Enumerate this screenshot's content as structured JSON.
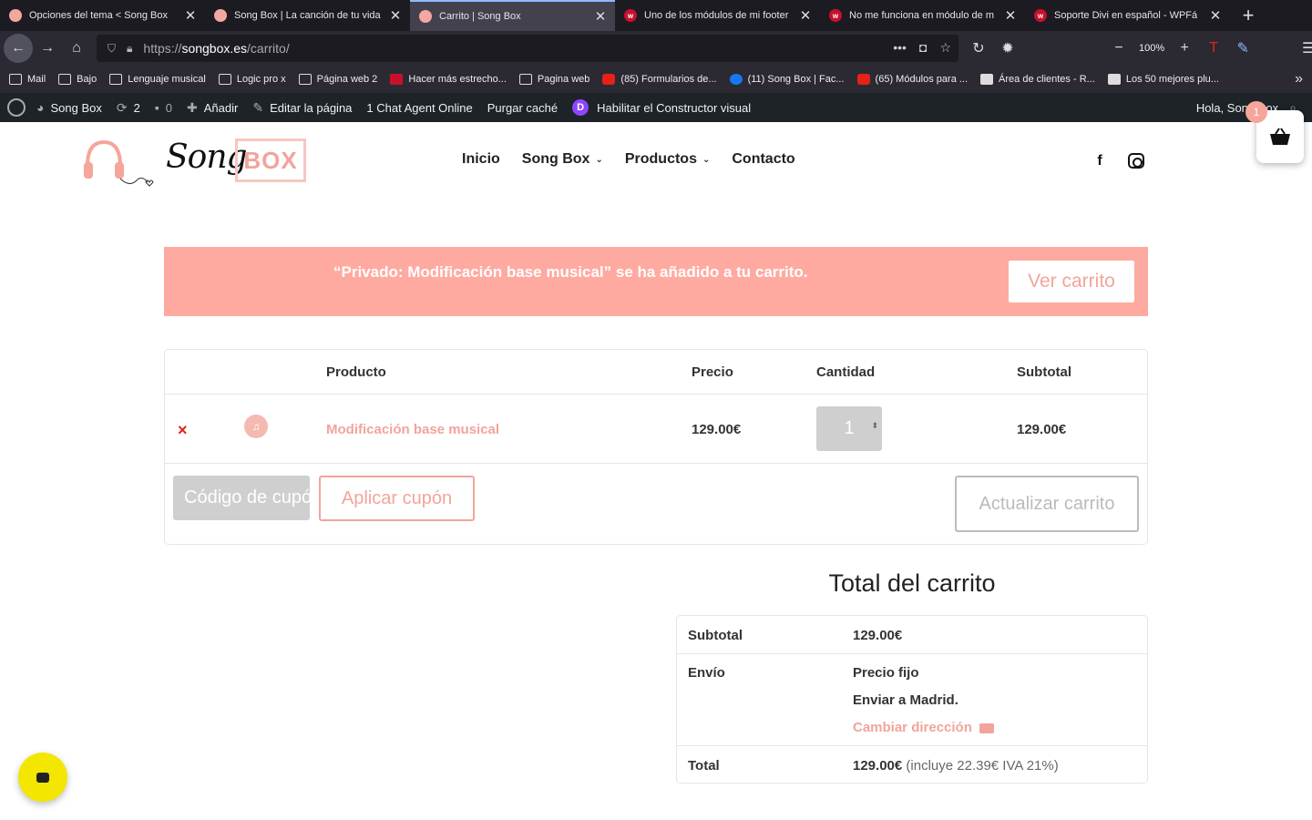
{
  "browser": {
    "tabs": [
      {
        "title": "Opciones del tema < Song Box",
        "favicon": "songbox-favicon",
        "active": false
      },
      {
        "title": "Song Box | La canción de tu vida",
        "favicon": "songbox-favicon",
        "active": false
      },
      {
        "title": "Carrito | Song Box",
        "favicon": "songbox-favicon",
        "active": true
      },
      {
        "title": "Uno de los módulos de mi footer",
        "favicon": "wpfacil-favicon",
        "active": false
      },
      {
        "title": "No me funciona en módulo de m",
        "favicon": "wpfacil-favicon",
        "active": false
      },
      {
        "title": "Soporte Divi en español - WPFá",
        "favicon": "wpfacil-favicon",
        "active": false
      }
    ],
    "url_prefix": "https://",
    "url_host": "songbox.es",
    "url_path": "/carrito/",
    "zoom": "100%",
    "bookmarks": [
      {
        "label": "Mail",
        "icon": "folder"
      },
      {
        "label": "Bajo",
        "icon": "folder"
      },
      {
        "label": "Lenguaje musical",
        "icon": "folder"
      },
      {
        "label": "Logic pro x",
        "icon": "folder"
      },
      {
        "label": "Página web 2",
        "icon": "folder"
      },
      {
        "label": "Hacer más estrecho...",
        "icon": "wp"
      },
      {
        "label": "Pagina web",
        "icon": "folder"
      },
      {
        "label": "(85) Formularios de...",
        "icon": "yt"
      },
      {
        "label": "(11) Song Box | Fac...",
        "icon": "fb"
      },
      {
        "label": "(65) Módulos para ...",
        "icon": "yt"
      },
      {
        "label": "Área de clientes - R...",
        "icon": "other"
      },
      {
        "label": "Los 50 mejores plu...",
        "icon": "other"
      }
    ]
  },
  "adminbar": {
    "site": "Song Box",
    "updates": "2",
    "comments": "0",
    "add": "Añadir",
    "edit": "Editar la página",
    "chat": "1 Chat Agent Online",
    "purge": "Purgar caché",
    "divi": "Habilitar el Constructor visual",
    "divi_letter": "D",
    "greeting": "Hola, Song Box"
  },
  "header": {
    "logo_script": "Song",
    "logo_box": "BOX",
    "menu": [
      {
        "label": "Inicio",
        "dropdown": false
      },
      {
        "label": "Song Box",
        "dropdown": true
      },
      {
        "label": "Productos",
        "dropdown": true
      },
      {
        "label": "Contacto",
        "dropdown": false
      }
    ],
    "facebook_glyph": "f",
    "cart_count": "1"
  },
  "notice": {
    "text": "“Privado: Modificación base musical” se ha añadido a tu carrito.",
    "button": "Ver carrito"
  },
  "cart": {
    "headers": {
      "product": "Producto",
      "price": "Precio",
      "quantity": "Cantidad",
      "subtotal": "Subtotal"
    },
    "item": {
      "remove": "×",
      "name": "Modificación base musical",
      "price": "129.00€",
      "quantity": "1",
      "subtotal": "129.00€"
    },
    "coupon_placeholder": "Código de cupón",
    "apply_coupon": "Aplicar cupón",
    "update_cart": "Actualizar carrito"
  },
  "totals": {
    "title": "Total del carrito",
    "subtotal_label": "Subtotal",
    "subtotal_value": "129.00€",
    "shipping_label": "Envío",
    "shipping_method": "Precio fijo",
    "shipping_dest": "Enviar a Madrid.",
    "change_address": "Cambiar dirección",
    "total_label": "Total",
    "total_value": "129.00€",
    "total_note": "(incluye 22.39€ IVA 21%)"
  },
  "colors": {
    "accent": "#f2a49b",
    "notice_bg": "#ffaaa0",
    "adminbar": "#1d2327",
    "chat": "#f3e600"
  }
}
